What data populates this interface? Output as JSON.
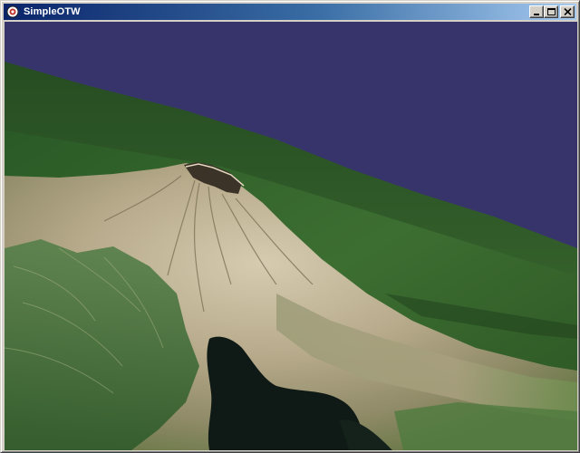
{
  "window": {
    "title": "SimpleOTW",
    "icon": "app-icon",
    "buttons": {
      "minimize": "minimize-icon",
      "maximize": "maximize-icon",
      "close": "close-icon"
    }
  },
  "scene": {
    "colors": {
      "sky": "#37346b",
      "forest_dark": "#1f4a1e",
      "forest": "#3a6b2f",
      "meadow": "#6f8a4a",
      "ash": "#b9ad8f",
      "ash_light": "#d8ccb0",
      "crater": "#3b3328",
      "lake": "#0f1a16"
    }
  }
}
